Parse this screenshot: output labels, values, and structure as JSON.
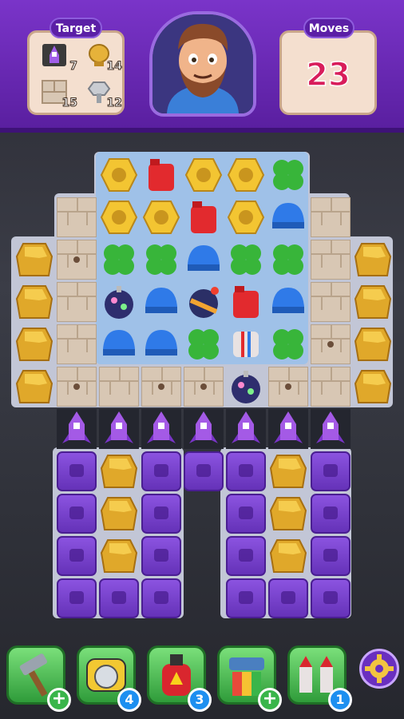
{
  "header": {
    "target_label": "Target",
    "moves_label": "Moves",
    "moves_value": "23",
    "targets": [
      {
        "icon": "purple-rocket-icon",
        "count": "7"
      },
      {
        "icon": "gold-trophy-icon",
        "count": "14"
      },
      {
        "icon": "brick-block-icon",
        "count": "15"
      },
      {
        "icon": "silver-bolt-icon",
        "count": "12"
      }
    ]
  },
  "boosters": [
    {
      "icon": "hammer-icon",
      "badge": "+"
    },
    {
      "icon": "saw-icon",
      "badge": "4"
    },
    {
      "icon": "fire-extinguisher-icon",
      "badge": "3"
    },
    {
      "icon": "paint-gun-icon",
      "badge": "+"
    },
    {
      "icon": "rockets-icon",
      "badge": "1"
    }
  ],
  "colors": {
    "header": "#6a2bb8",
    "moves": "#d81d5b",
    "crate": "#7a41d0",
    "green_booster": "#3fb24a"
  }
}
